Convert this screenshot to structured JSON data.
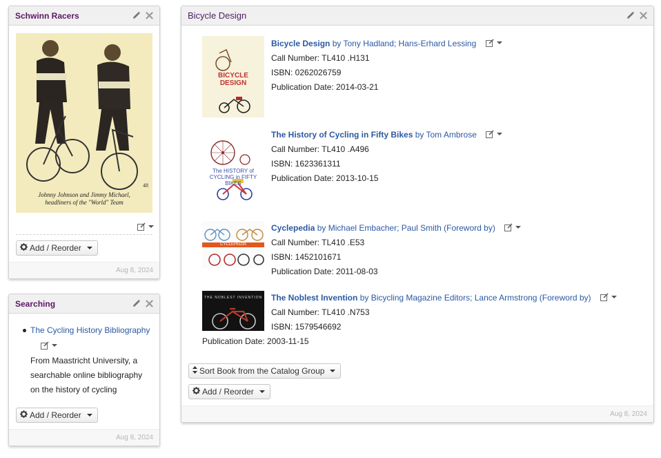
{
  "schwinn": {
    "title": "Schwinn Racers",
    "caption_line1": "Johnny Johnson and Jimmy Michael,",
    "caption_line2": "headliners of the \"World\" Team",
    "page_number": "48",
    "add_reorder_label": "Add / Reorder",
    "date": "Aug 8, 2024"
  },
  "searching": {
    "title": "Searching",
    "link_text": "The Cycling History Bibliography",
    "description_line1": "From Maastricht University, a",
    "description_line2": "searchable online bibliography",
    "description_line3": "on the history of cycling",
    "add_reorder_label": "Add / Reorder",
    "date": "Aug 8, 2024"
  },
  "bicycle_design": {
    "title": "Bicycle Design",
    "books": [
      {
        "title": "Bicycle Design",
        "authors": "by Tony Hadland; Hans-Erhard Lessing",
        "call_number": "Call Number: TL410 .H131",
        "isbn": "ISBN: 0262026759",
        "pub_date": "Publication Date: 2014-03-21",
        "cover_text": "BICYCLE DESIGN"
      },
      {
        "title": "The History of Cycling in Fifty Bikes",
        "authors": "by Tom Ambrose",
        "call_number": "Call Number: TL410 .A496",
        "isbn": "ISBN: 1623361311",
        "pub_date": "Publication Date: 2013-10-15",
        "cover_text": "The HISTORY of CYCLING in FIFTY BIKES"
      },
      {
        "title": "Cyclepedia",
        "authors": "by Michael Embacher; Paul Smith (Foreword by)",
        "call_number": "Call Number: TL410 .E53",
        "isbn": "ISBN: 1452101671",
        "pub_date": "Publication Date: 2011-08-03",
        "cover_text": "CYCLEPEDIA"
      },
      {
        "title": "The Noblest Invention",
        "authors": "by Bicycling Magazine Editors; Lance Armstrong (Foreword by)",
        "call_number": "Call Number: TL410 .N753",
        "isbn": "ISBN: 1579546692",
        "pub_date": "Publication Date: 2003-11-15",
        "cover_text": "THE NOBLEST INVENTION"
      }
    ],
    "sort_label": "Sort Book from the Catalog Group",
    "add_reorder_label": "Add / Reorder",
    "date": "Aug 8, 2024"
  },
  "icons": {
    "edit": "pencil-icon",
    "close": "close-icon",
    "gear": "gear-icon",
    "sort": "sort-icon",
    "edit_dropdown": "edit-dropdown-icon"
  },
  "colors": {
    "title_purple": "#5b1763",
    "link_blue": "#2b58a3",
    "header_bg": "#f0f0f0"
  }
}
